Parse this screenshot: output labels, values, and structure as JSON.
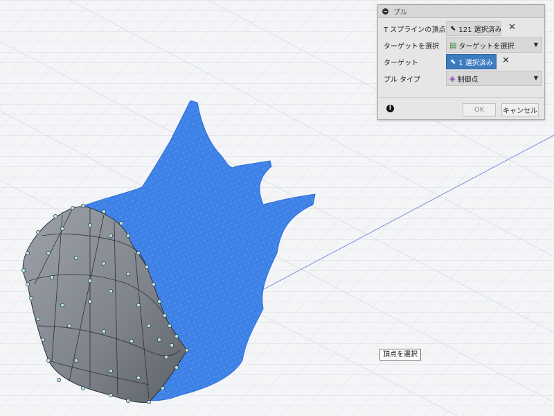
{
  "dialog": {
    "title": "プル",
    "rows": {
      "tspline_vertices": {
        "label": "T スプラインの頂点",
        "value": "121 選択済み"
      },
      "select_target": {
        "label": "ターゲットを選択",
        "value": "ターゲットを選択"
      },
      "target": {
        "label": "ターゲット",
        "value": "1 選択済み"
      },
      "pull_type": {
        "label": "プル タイプ",
        "value": "制御点"
      }
    },
    "ok_label": "OK",
    "cancel_label": "キャンセル"
  },
  "tooltip": {
    "text": "頂点を選択"
  },
  "colors": {
    "mesh_blue": "#3a7fe6",
    "tspline_gray": "#8a8f98",
    "selection_accent": "#3d7bbf",
    "vertex_dot": "#bfe3dd"
  },
  "icons": {
    "collapse": "collapse-icon",
    "cursor": "cursor-icon",
    "target_select": "target-select-icon",
    "control_point": "control-point-icon",
    "info": "info-icon",
    "clear": "close-icon"
  }
}
